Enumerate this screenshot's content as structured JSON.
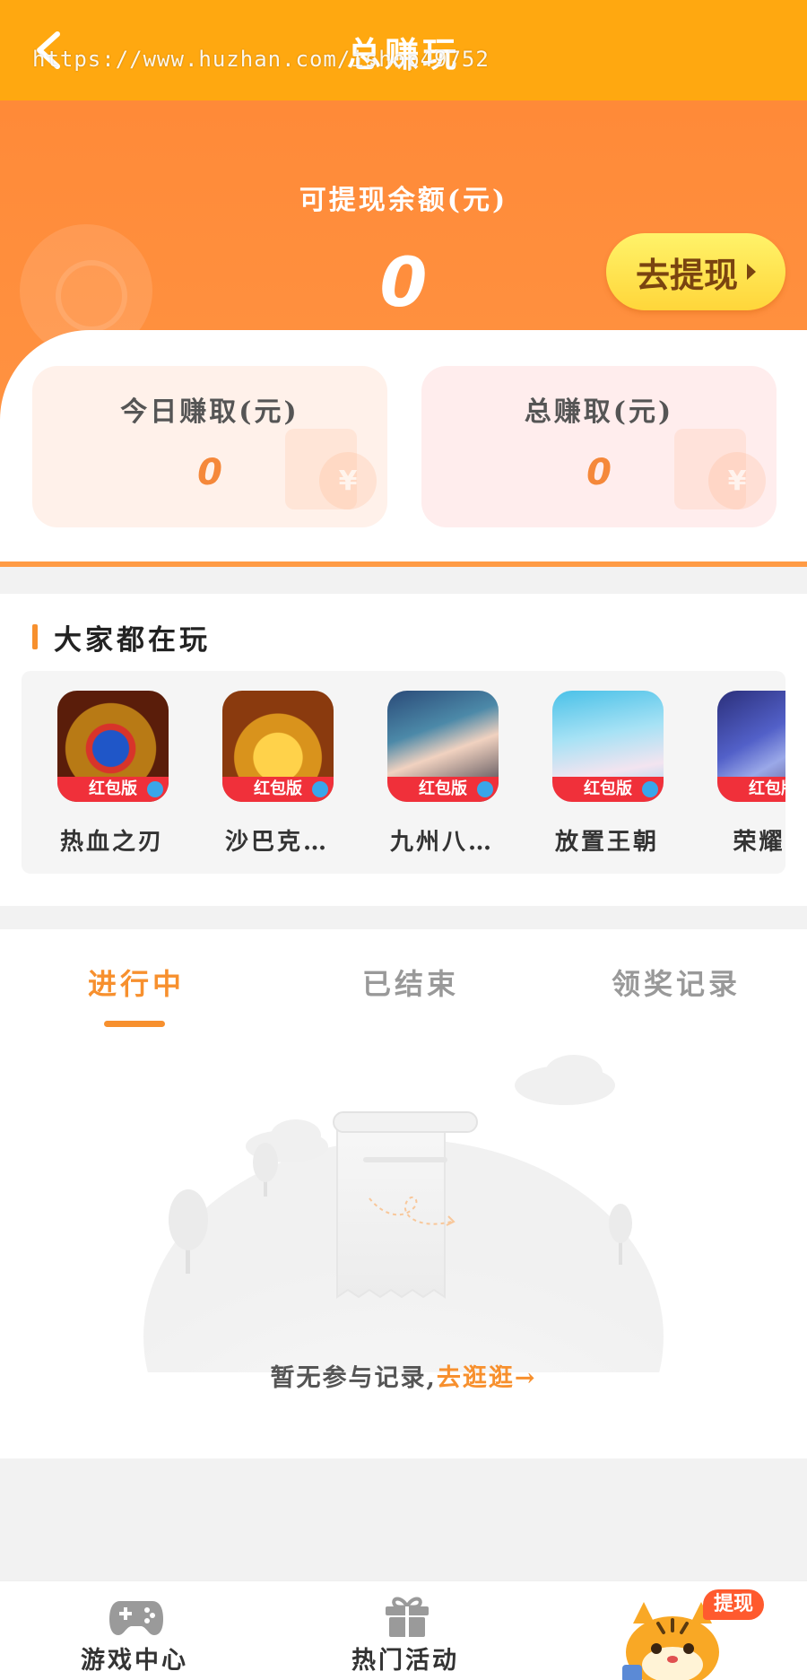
{
  "header": {
    "title": "总赚玩",
    "watermark": "https://www.huzhan.com/ishop49752"
  },
  "balance": {
    "label": "可提现余额(元)",
    "amount": "0",
    "withdraw_button": "去提现"
  },
  "stats": {
    "today_label": "今日赚取(元)",
    "today_value": "0",
    "total_label": "总赚取(元)",
    "total_value": "0",
    "coin_symbol": "¥"
  },
  "popular": {
    "title": "大家都在玩",
    "badge": "红包版",
    "games": [
      {
        "name": "热血之刃"
      },
      {
        "name": "沙巴克…"
      },
      {
        "name": "九州八…"
      },
      {
        "name": "放置王朝"
      },
      {
        "name": "荣耀岭"
      }
    ]
  },
  "records": {
    "tabs": [
      "进行中",
      "已结束",
      "领奖记录"
    ],
    "empty_text": "暂无参与记录,",
    "empty_link": "去逛逛→"
  },
  "bottom_nav": {
    "games": "游戏中心",
    "events": "热门活动",
    "withdraw_badge": "提现"
  },
  "colors": {
    "header": "#ffa810",
    "accent": "#f7902e",
    "hero": "#ff8a38",
    "withdraw_button": "#ffe04a"
  }
}
